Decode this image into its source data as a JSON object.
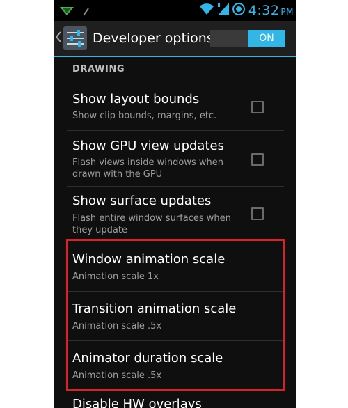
{
  "status_bar": {
    "time": "4:32",
    "ampm": "PM",
    "icons": [
      "notification-app-icon",
      "notification-sub-icon",
      "wifi-icon",
      "signal-icon",
      "battery-icon"
    ]
  },
  "action_bar": {
    "title": "Developer options",
    "switch_label": "ON",
    "icons": [
      "back-chevron-icon",
      "settings-sliders-icon"
    ]
  },
  "section": {
    "header": "DRAWING"
  },
  "prefs": [
    {
      "title": "Show layout bounds",
      "summary": "Show clip bounds, margins, etc.",
      "checked": false
    },
    {
      "title": "Show GPU view updates",
      "summary": "Flash views inside windows when drawn with the GPU",
      "checked": false
    },
    {
      "title": "Show surface updates",
      "summary": "Flash entire window surfaces when they update",
      "checked": false
    },
    {
      "title": "Window animation scale",
      "summary": "Animation scale 1x"
    },
    {
      "title": "Transition animation scale",
      "summary": "Animation scale .5x"
    },
    {
      "title": "Animator duration scale",
      "summary": "Animation scale .5x"
    },
    {
      "title": "Disable HW overlays"
    }
  ],
  "colors": {
    "accent": "#33b5e5",
    "highlight": "#d6222a",
    "background": "#0f0f0f"
  }
}
